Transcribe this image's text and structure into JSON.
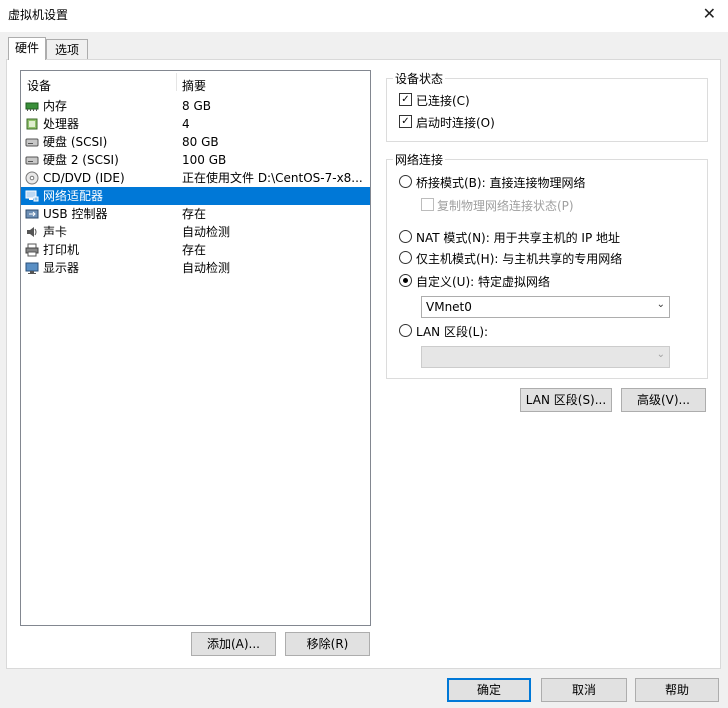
{
  "window": {
    "title": "虚拟机设置",
    "close_glyph": "✕"
  },
  "tabs": [
    {
      "label": "硬件"
    },
    {
      "label": "选项"
    }
  ],
  "device_list": {
    "col_device": "设备",
    "col_summary": "摘要",
    "rows": [
      {
        "name": "内存",
        "summary": "8 GB",
        "icon": "memory-icon"
      },
      {
        "name": "处理器",
        "summary": "4",
        "icon": "cpu-icon"
      },
      {
        "name": "硬盘 (SCSI)",
        "summary": "80 GB",
        "icon": "hard-disk-icon"
      },
      {
        "name": "硬盘 2 (SCSI)",
        "summary": "100 GB",
        "icon": "hard-disk-icon"
      },
      {
        "name": "CD/DVD (IDE)",
        "summary": "正在使用文件 D:\\CentOS-7-x8...",
        "icon": "cd-dvd-icon"
      },
      {
        "name": "网络适配器",
        "summary": "",
        "icon": "network-adapter-icon"
      },
      {
        "name": "USB 控制器",
        "summary": "存在",
        "icon": "usb-icon"
      },
      {
        "name": "声卡",
        "summary": "自动检测",
        "icon": "sound-card-icon"
      },
      {
        "name": "打印机",
        "summary": "存在",
        "icon": "printer-icon"
      },
      {
        "name": "显示器",
        "summary": "自动检测",
        "icon": "display-icon"
      }
    ],
    "selected_index": 5
  },
  "list_buttons": {
    "add": "添加(A)...",
    "remove": "移除(R)"
  },
  "device_status": {
    "title": "设备状态",
    "connected": "已连接(C)",
    "connect_at_power_on": "启动时连接(O)"
  },
  "network": {
    "title": "网络连接",
    "bridged": "桥接模式(B): 直接连接物理网络",
    "replicate": "复制物理网络连接状态(P)",
    "nat": "NAT 模式(N): 用于共享主机的 IP 地址",
    "host_only": "仅主机模式(H): 与主机共享的专用网络",
    "custom": "自定义(U): 特定虚拟网络",
    "custom_value": "VMnet0",
    "lan": "LAN 区段(L):",
    "lan_value": ""
  },
  "network_buttons": {
    "lan_segments": "LAN 区段(S)...",
    "advanced": "高级(V)..."
  },
  "footer": {
    "ok": "确定",
    "cancel": "取消",
    "help": "帮助"
  },
  "colors": {
    "selection": "#0078d7"
  }
}
